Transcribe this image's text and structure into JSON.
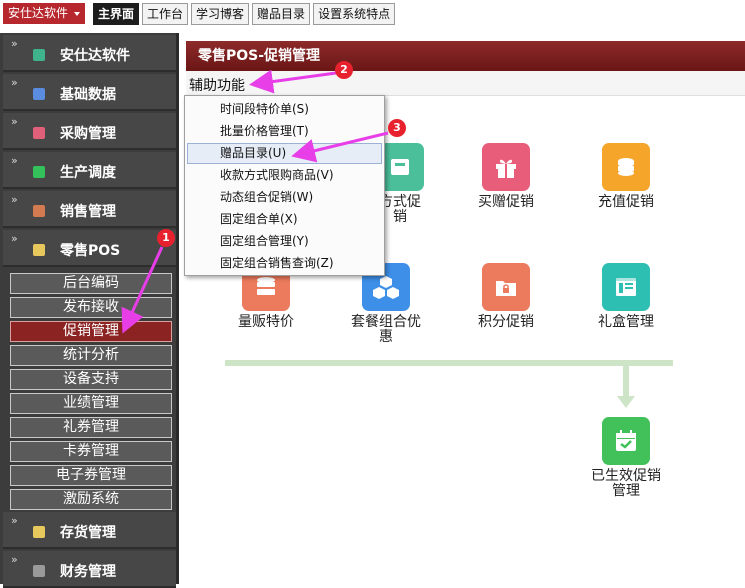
{
  "topbar": {
    "app_menu": "安仕达软件",
    "tabs": [
      {
        "label": "主界面",
        "active": true
      },
      {
        "label": "工作台",
        "active": false
      },
      {
        "label": "学习博客",
        "active": false
      },
      {
        "label": "赠品目录",
        "active": false
      },
      {
        "label": "设置系统特点",
        "active": false
      }
    ]
  },
  "sidebar": {
    "modules": [
      {
        "label": "安仕达软件",
        "icon": "app-icon",
        "color": "#3fb38b"
      },
      {
        "label": "基础数据",
        "icon": "database-icon",
        "color": "#5a8de0"
      },
      {
        "label": "采购管理",
        "icon": "cart-icon",
        "color": "#e0607a"
      },
      {
        "label": "生产调度",
        "icon": "factory-icon",
        "color": "#34c05a"
      },
      {
        "label": "销售管理",
        "icon": "sales-icon",
        "color": "#d27a50"
      },
      {
        "label": "零售POS",
        "icon": "pos-icon",
        "color": "#e6c85c"
      }
    ],
    "sub_items": [
      {
        "label": "后台编码",
        "active": false
      },
      {
        "label": "发布接收",
        "active": false
      },
      {
        "label": "促销管理",
        "active": true
      },
      {
        "label": "统计分析",
        "active": false
      },
      {
        "label": "设备支持",
        "active": false
      },
      {
        "label": "业绩管理",
        "active": false
      },
      {
        "label": "礼券管理",
        "active": false
      },
      {
        "label": "卡券管理",
        "active": false
      },
      {
        "label": "电子券管理",
        "active": false
      },
      {
        "label": "激励系统",
        "active": false
      }
    ],
    "lower_modules": [
      {
        "label": "存货管理",
        "icon": "inventory-icon",
        "color": "#e6c85c"
      },
      {
        "label": "财务管理",
        "icon": "finance-icon",
        "color": "#9a9a9a"
      }
    ]
  },
  "main": {
    "panel_title": "零售POS-促销管理",
    "toolbar_button": "辅助功能",
    "dropdown": [
      {
        "label": "时间段特价单(S)",
        "highlight": false
      },
      {
        "label": "批量价格管理(T)",
        "highlight": false
      },
      {
        "label": "赠品目录(U)",
        "highlight": true
      },
      {
        "label": "收款方式限购商品(V)",
        "highlight": false
      },
      {
        "label": "动态组合促销(W)",
        "highlight": false
      },
      {
        "label": "固定组合单(X)",
        "highlight": false
      },
      {
        "label": "固定组合管理(Y)",
        "highlight": false
      },
      {
        "label": "固定组合销售查询(Z)",
        "highlight": false
      }
    ],
    "tiles": [
      {
        "label": "方式促\n销",
        "icon": "payment-promo-icon",
        "color": "#4bbf9a"
      },
      {
        "label": "买赠促销",
        "icon": "gift-icon",
        "color": "#e85d79"
      },
      {
        "label": "充值促销",
        "icon": "coins-icon",
        "color": "#f4a52a"
      },
      {
        "label": "量贩特价",
        "icon": "stack-icon",
        "color": "#ec7a5c"
      },
      {
        "label": "套餐组合优\n惠",
        "icon": "cubes-icon",
        "color": "#3d8fe8"
      },
      {
        "label": "积分促销",
        "icon": "folder-lock-icon",
        "color": "#ec7a5c"
      },
      {
        "label": "礼盒管理",
        "icon": "window-icon",
        "color": "#2dbfb1"
      },
      {
        "label": "已生效促销\n管理",
        "icon": "calendar-check-icon",
        "color": "#42c05a"
      }
    ]
  },
  "annotations": [
    "1",
    "2",
    "3"
  ],
  "colors": {
    "accent_red": "#b7282e",
    "annotation_pink": "#e83ee8",
    "connector_green": "#cde5c6"
  }
}
